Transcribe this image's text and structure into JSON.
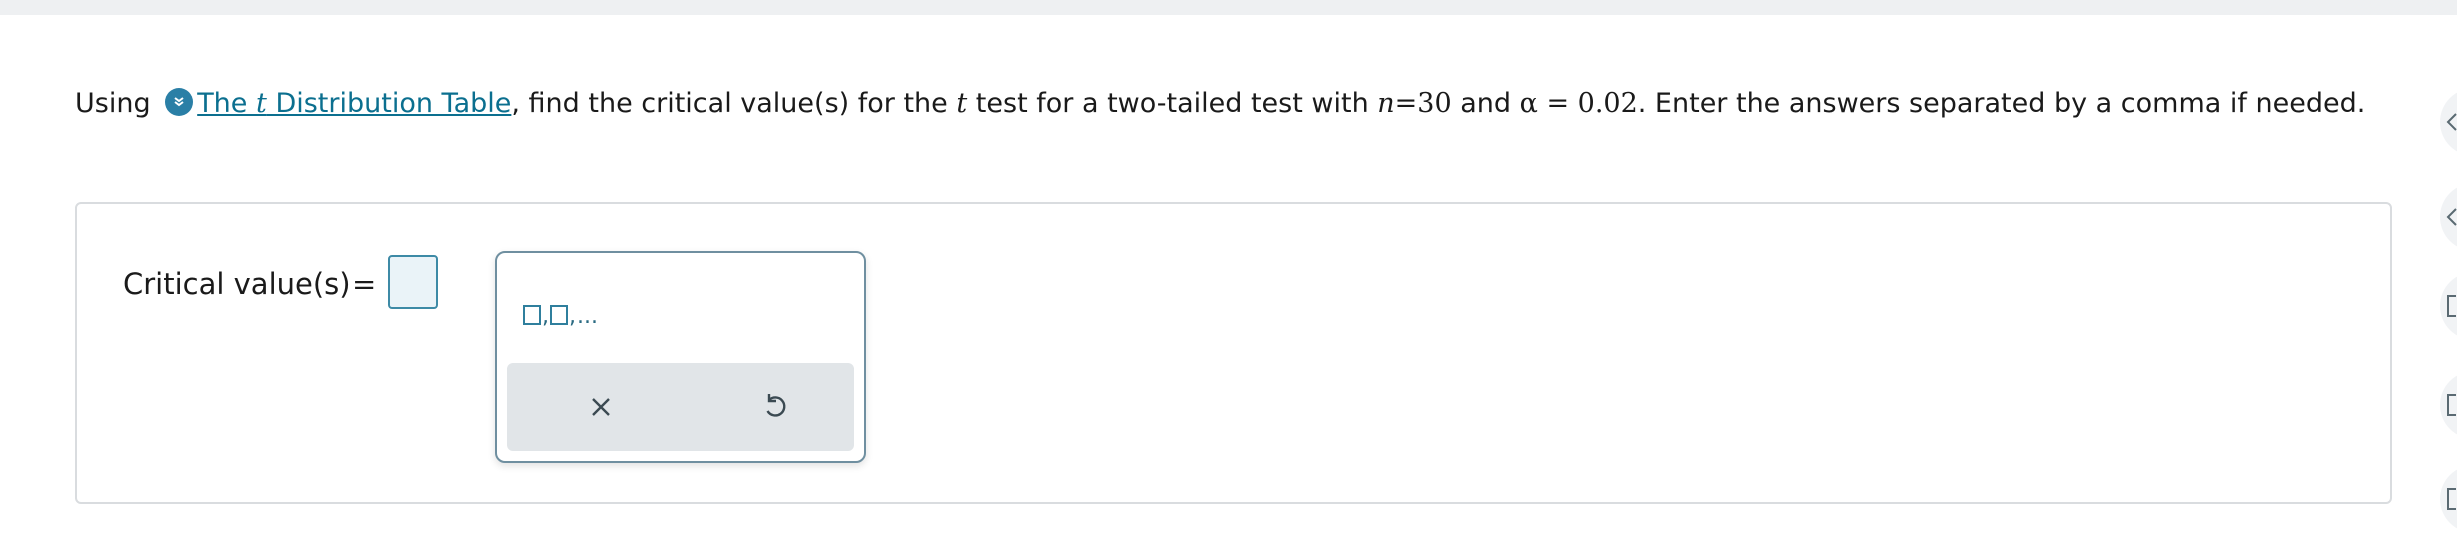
{
  "question": {
    "prefix": "Using",
    "link_pre": "The ",
    "link_var": "t",
    "link_post": " Distribution Table",
    "text_1": ", find the critical value(s) for the ",
    "var_t": "t",
    "text_2": " test for a two-tailed test with ",
    "var_n": "n",
    "eq_n": "=30",
    "text_3": " and ",
    "alpha": "α",
    "eq_alpha": " = 0.02",
    "text_4": ". Enter the answers separated by a comma if needed."
  },
  "answer": {
    "label": "Critical value(s)",
    "equals": "=",
    "value": ""
  },
  "palette": {
    "template_ellipsis": "...",
    "comma": ","
  },
  "colors": {
    "link": "#0b6f8f",
    "accent": "#2a7fa6",
    "input_border": "#3d8aa6",
    "palette_bar": "#e1e5e8"
  },
  "icons": {
    "download": "download-icon",
    "clear": "close-icon",
    "undo": "undo-icon"
  }
}
